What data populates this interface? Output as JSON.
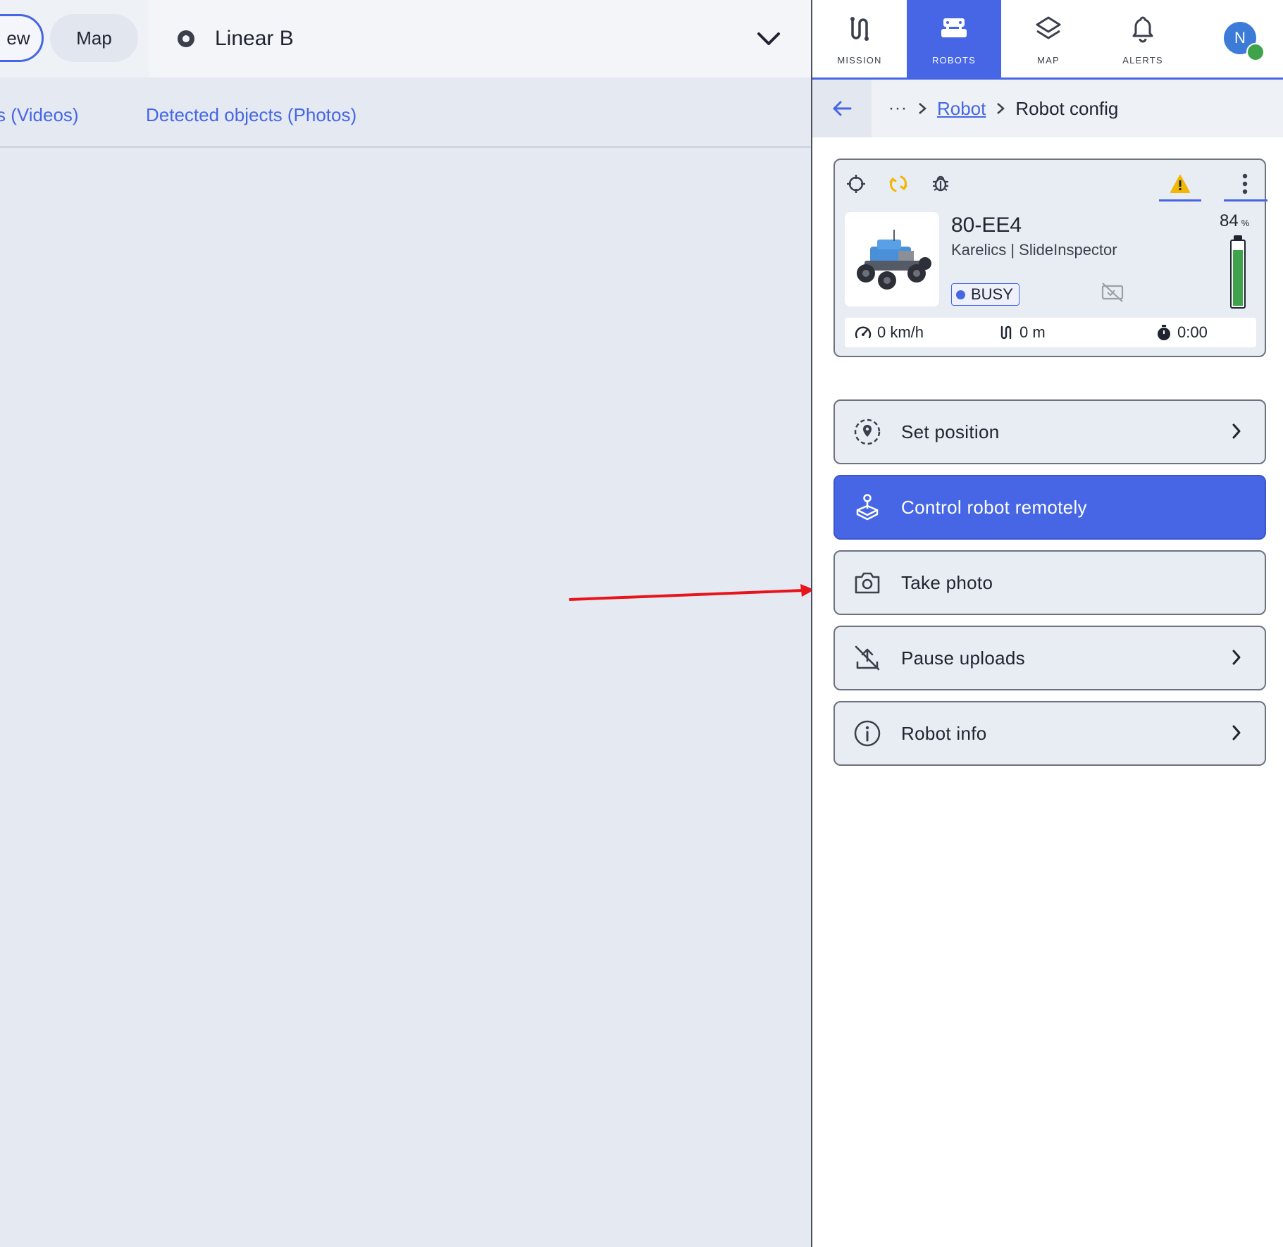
{
  "view_toggle": {
    "view_label": "ew",
    "map_label": "Map"
  },
  "site_selector": {
    "value": "Linear B"
  },
  "tabs": [
    {
      "label": "s (Videos)"
    },
    {
      "label": "Detected objects (Photos)"
    }
  ],
  "nav": {
    "items": [
      {
        "label": "MISSION",
        "icon": "route-icon"
      },
      {
        "label": "ROBOTS",
        "icon": "robot-icon",
        "active": true
      },
      {
        "label": "MAP",
        "icon": "layers-icon"
      },
      {
        "label": "ALERTS",
        "icon": "bell-icon"
      }
    ],
    "avatar_initial": "N"
  },
  "breadcrumb": {
    "ellipsis": "···",
    "parent": "Robot",
    "current": "Robot config"
  },
  "robot": {
    "name": "80-EE4",
    "subtitle": "Karelics | SlideInspector",
    "status": "BUSY",
    "battery_value": "84",
    "battery_unit": "%",
    "battery_level": 0.84,
    "speed": "0 km/h",
    "distance": "0 m",
    "duration": "0:00"
  },
  "actions": [
    {
      "label": "Set position",
      "icon": "location-target-icon",
      "has_chevron": true
    },
    {
      "label": "Control robot remotely",
      "icon": "joystick-icon",
      "has_chevron": false,
      "primary": true
    },
    {
      "label": "Take photo",
      "icon": "camera-icon",
      "has_chevron": false
    },
    {
      "label": "Pause uploads",
      "icon": "upload-off-icon",
      "has_chevron": true
    },
    {
      "label": "Robot info",
      "icon": "info-icon",
      "has_chevron": true
    }
  ],
  "colors": {
    "accent": "#4666e5",
    "battery": "#3ea34a",
    "warning": "#f2b705",
    "annotation": "#e8141b"
  }
}
